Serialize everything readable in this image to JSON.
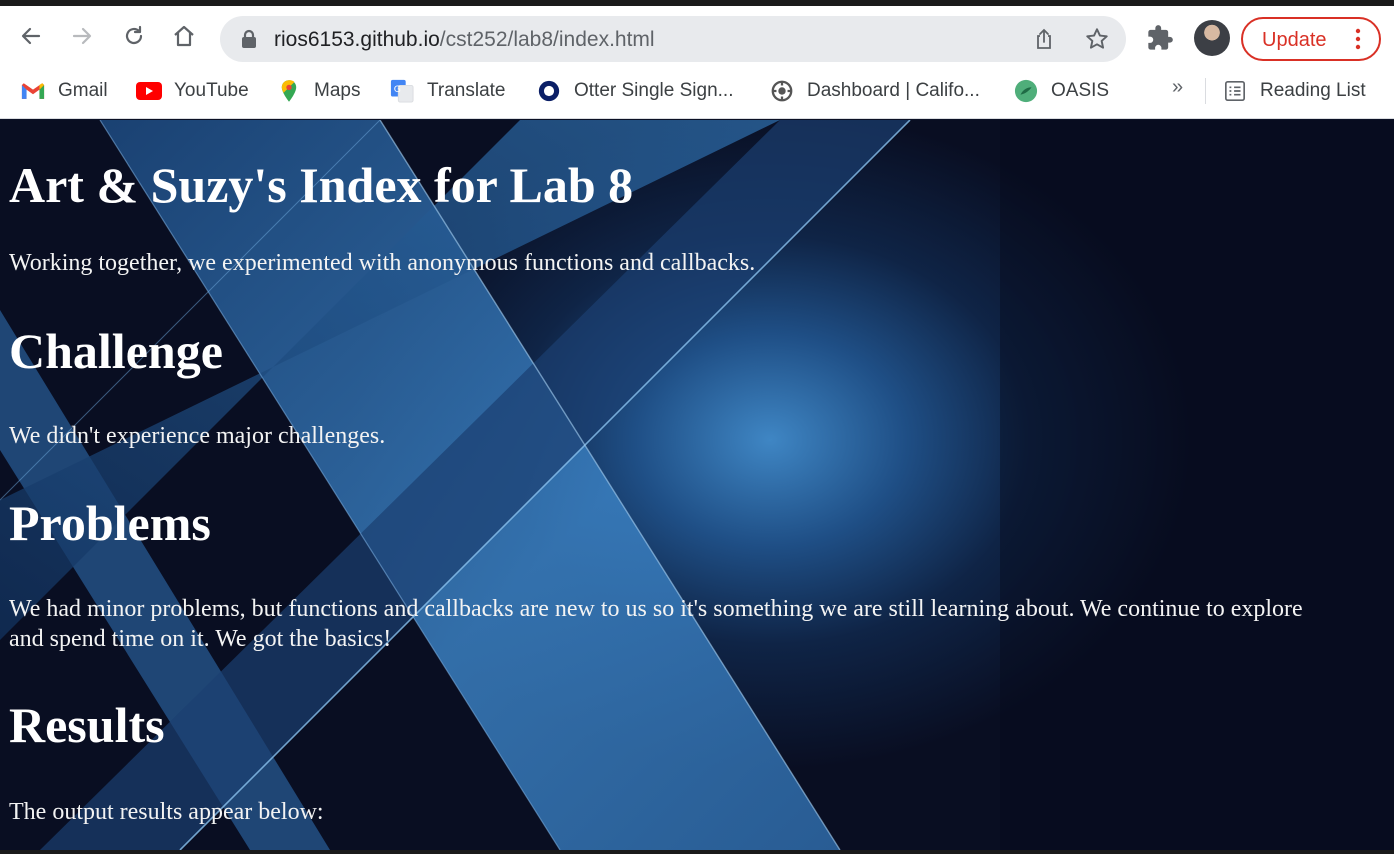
{
  "browser": {
    "url_host": "rios6153.github.io",
    "url_path": "/cst252/lab8/index.html",
    "update_label": "Update",
    "bookmarks": [
      {
        "label": "Gmail",
        "icon": "gmail-icon"
      },
      {
        "label": "YouTube",
        "icon": "youtube-icon"
      },
      {
        "label": "Maps",
        "icon": "maps-icon"
      },
      {
        "label": "Translate",
        "icon": "translate-icon"
      },
      {
        "label": "Otter Single Sign...",
        "icon": "otter-icon"
      },
      {
        "label": "Dashboard | Califo...",
        "icon": "dashboard-icon"
      },
      {
        "label": "OASIS",
        "icon": "oasis-icon"
      }
    ],
    "overflow_label": "»",
    "reading_list_label": "Reading List"
  },
  "page": {
    "title": "Art & Suzy's Index for Lab 8",
    "intro": "Working together, we experimented with anonymous functions and callbacks.",
    "challenge_heading": "Challenge",
    "challenge_text": "We didn't experience major challenges.",
    "problems_heading": "Problems",
    "problems_text": "We had minor problems, but functions and callbacks are new to us so it's something we are still learning about. We continue to explore and spend time on it. We got the basics!",
    "results_heading": "Results",
    "results_text": "The output results appear below:"
  },
  "colors": {
    "update_red": "#d93025",
    "page_bg_dark": "#090e22",
    "page_band_blue": "#3a78b8"
  }
}
